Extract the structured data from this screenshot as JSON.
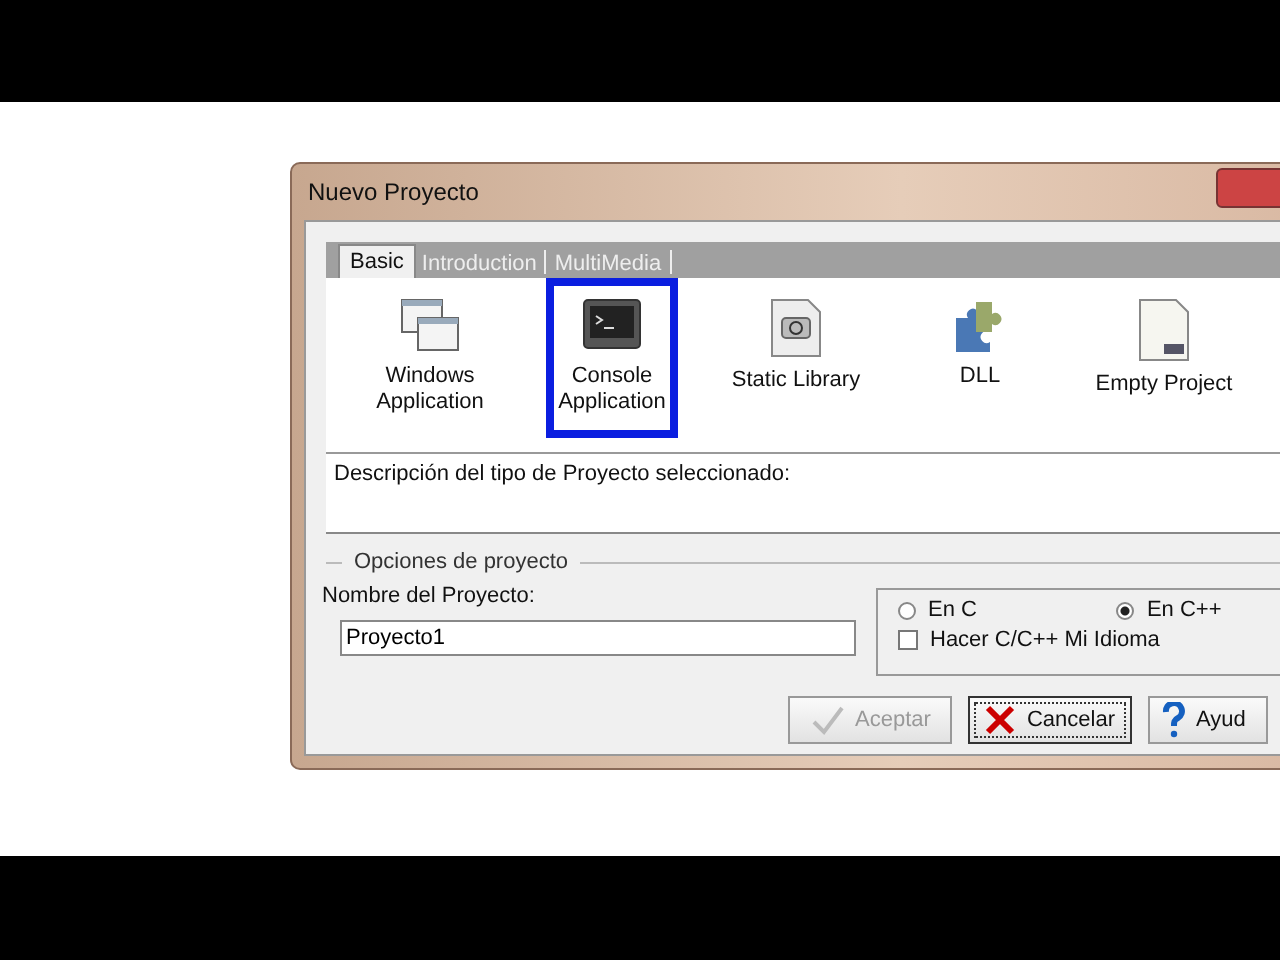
{
  "window": {
    "title": "Nuevo Proyecto"
  },
  "tabs": [
    {
      "label": "Basic",
      "selected": true
    },
    {
      "label": "Introduction",
      "selected": false
    },
    {
      "label": "MultiMedia",
      "selected": false
    }
  ],
  "project_types": [
    {
      "label": "Windows Application",
      "kind": "windows",
      "selected": false
    },
    {
      "label": "Console Application",
      "kind": "console",
      "selected": true
    },
    {
      "label": "Static Library",
      "kind": "library",
      "selected": false
    },
    {
      "label": "DLL",
      "kind": "dll",
      "selected": false
    },
    {
      "label": "Empty Project",
      "kind": "empty",
      "selected": false
    }
  ],
  "description": "Descripción del tipo de Proyecto seleccionado:",
  "options": {
    "title": "Opciones de proyecto",
    "name_label": "Nombre del Proyecto:",
    "name_value": "Proyecto1",
    "languages": [
      {
        "label": "En C",
        "selected": false
      },
      {
        "label": "En C++",
        "selected": true
      }
    ],
    "default_language": {
      "label": "Hacer C/C++ Mi Idioma",
      "checked": false
    }
  },
  "buttons": [
    {
      "label": "Aceptar",
      "kind": "ok",
      "disabled": true
    },
    {
      "label": "Cancelar",
      "kind": "cancel",
      "disabled": false
    },
    {
      "label": "Ayud",
      "kind": "help",
      "disabled": false
    }
  ]
}
